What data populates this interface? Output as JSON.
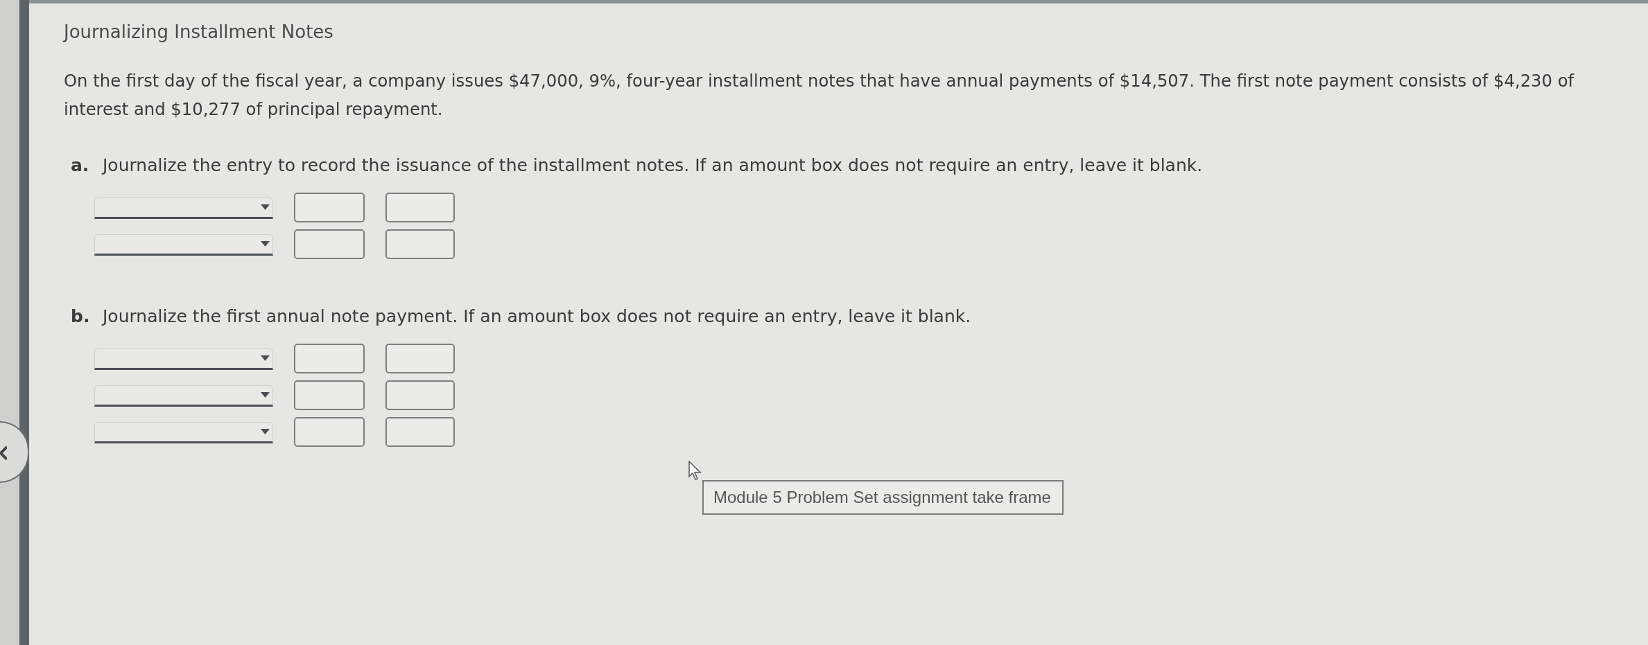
{
  "title": "Journalizing Installment Notes",
  "intro": "On the first day of the fiscal year, a company issues $47,000, 9%, four-year installment notes that have annual payments of $14,507. The first note payment consists of $4,230 of interest and $10,277 of principal repayment.",
  "parts": [
    {
      "label": "a.",
      "instruction": "Journalize the entry to record the issuance of the installment notes. If an amount box does not require an entry, leave it blank.",
      "rows": [
        {
          "kind": "entry"
        },
        {
          "kind": "entry"
        }
      ]
    },
    {
      "label": "b.",
      "instruction": "Journalize the first annual note payment. If an amount box does not require an entry, leave it blank.",
      "rows": [
        {
          "kind": "entry"
        },
        {
          "kind": "entry"
        },
        {
          "kind": "entry"
        }
      ]
    }
  ],
  "tooltip": {
    "text": "Module 5 Problem Set assignment take frame"
  }
}
